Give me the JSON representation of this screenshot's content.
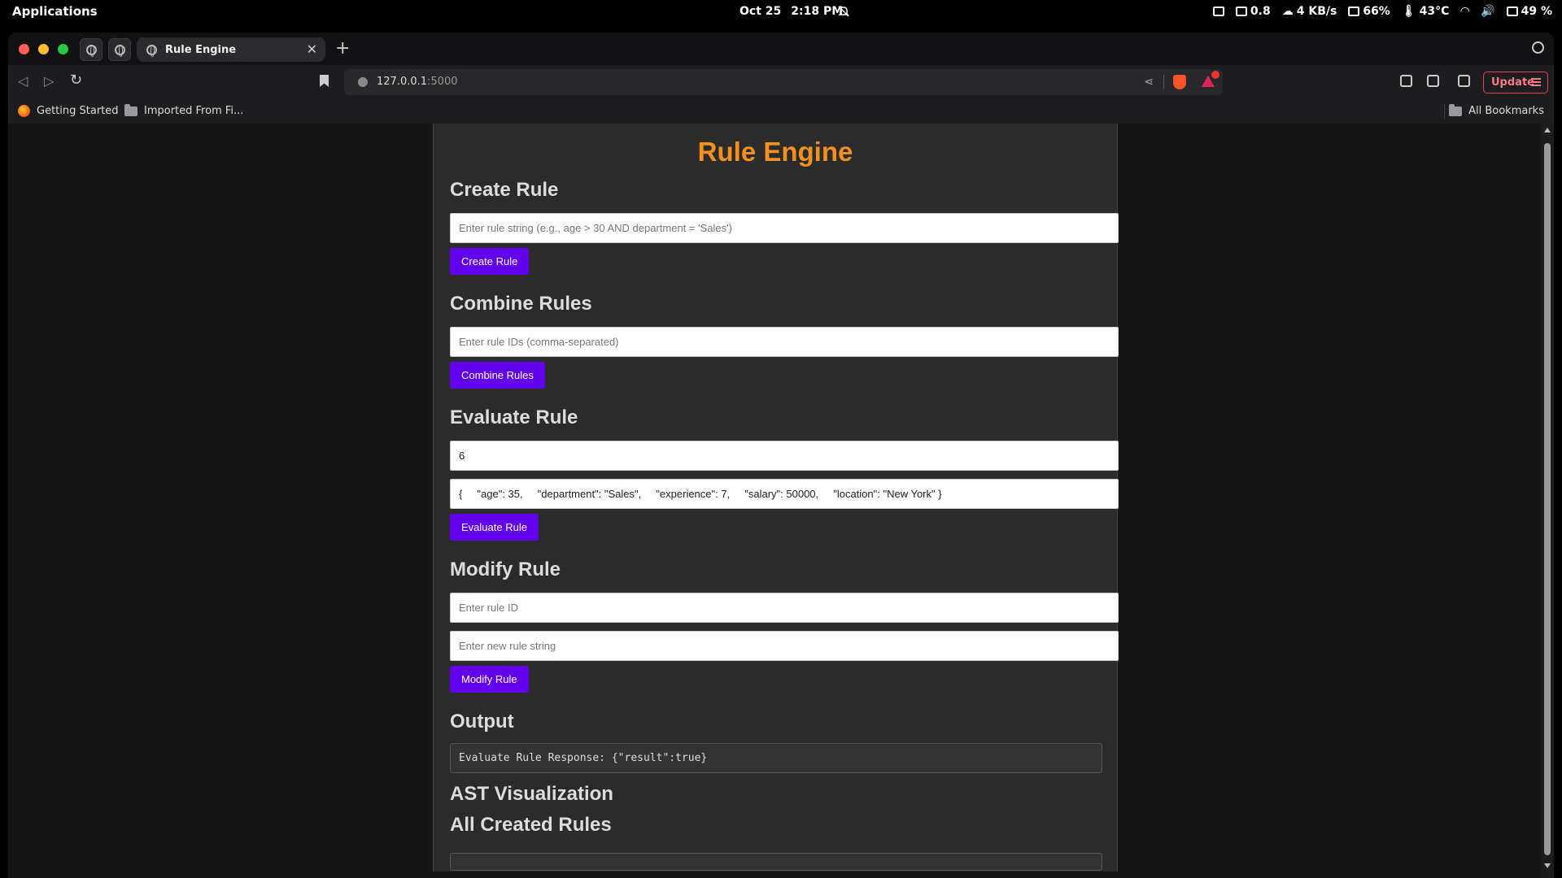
{
  "system_bar": {
    "apps_label": "Applications",
    "date": "Oct 25",
    "time": "2:18 PM",
    "load": "0.8",
    "network": "4 KB/s",
    "memory": "66%",
    "temperature": "43°C",
    "battery": "49 %"
  },
  "browser": {
    "tab_title": "Rule Engine",
    "url_host": "127.0.0.1",
    "url_port": ":5000",
    "update_label": "Update",
    "bookmarks": [
      "Getting Started",
      "Imported From Fi..."
    ],
    "all_bookmarks_label": "All Bookmarks"
  },
  "page": {
    "title": "Rule Engine",
    "create": {
      "heading": "Create Rule",
      "placeholder": "Enter rule string (e.g., age > 30 AND department = 'Sales')",
      "button": "Create Rule"
    },
    "combine": {
      "heading": "Combine Rules",
      "placeholder": "Enter rule IDs (comma-separated)",
      "button": "Combine Rules"
    },
    "evaluate": {
      "heading": "Evaluate Rule",
      "rule_id_value": "6",
      "data_value": "{     \"age\": 35,     \"department\": \"Sales\",     \"experience\": 7,     \"salary\": 50000,     \"location\": \"New York\" }",
      "button": "Evaluate Rule"
    },
    "modify": {
      "heading": "Modify Rule",
      "id_placeholder": "Enter rule ID",
      "string_placeholder": "Enter new rule string",
      "button": "Modify Rule"
    },
    "output": {
      "heading": "Output",
      "text": "Evaluate Rule Response: {\"result\":true}"
    },
    "ast_heading": "AST Visualization",
    "rules_heading": "All Created Rules"
  },
  "colors": {
    "title": "#f39020",
    "button": "#6200ee",
    "panel": "#2b2b2b",
    "update_accent": "#e0445e"
  }
}
